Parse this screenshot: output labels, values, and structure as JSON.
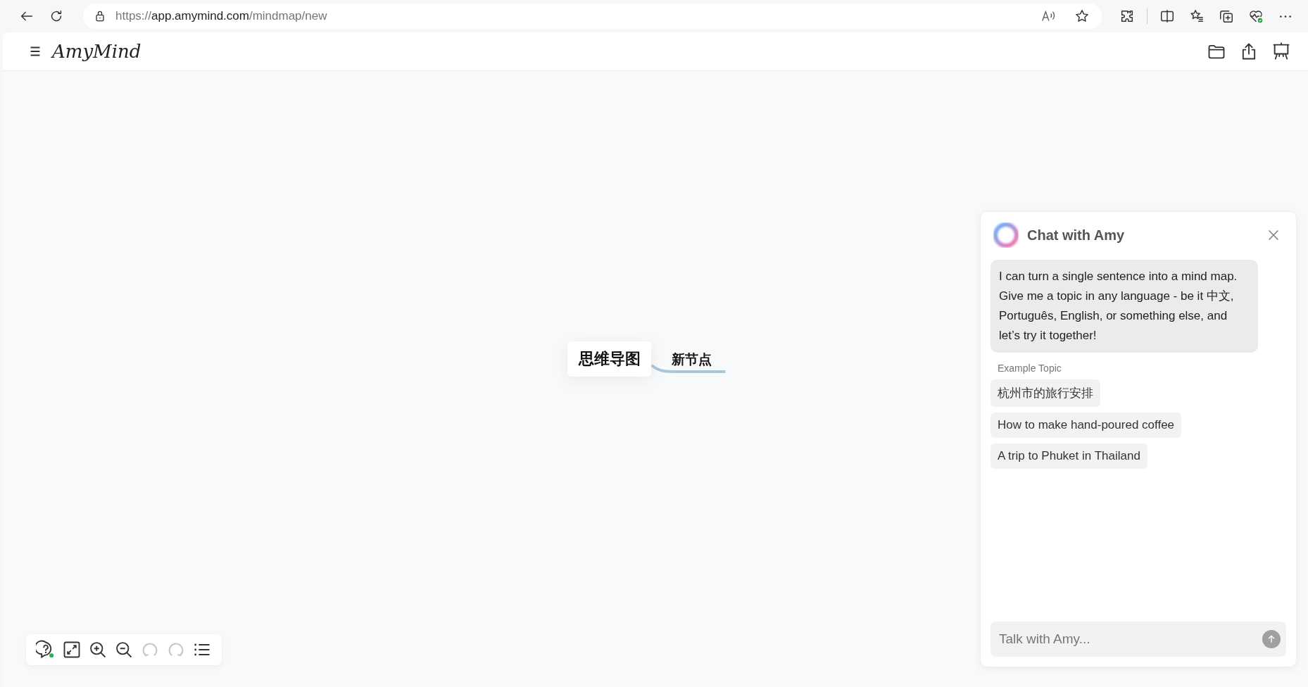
{
  "browser": {
    "url": {
      "scheme": "https://",
      "host": "app.amymind.com",
      "path": "/mindmap/new"
    }
  },
  "app_header": {
    "logo": "AmyMind"
  },
  "mindmap": {
    "root": "思维导图",
    "children": [
      {
        "label": "新节点"
      }
    ]
  },
  "toolbar": [
    {
      "kind": "help",
      "disabled": false
    },
    {
      "kind": "fit",
      "disabled": false
    },
    {
      "kind": "zoom-in",
      "disabled": false
    },
    {
      "kind": "zoom-out",
      "disabled": false
    },
    {
      "kind": "undo",
      "disabled": true
    },
    {
      "kind": "redo",
      "disabled": true
    },
    {
      "kind": "outline",
      "disabled": false
    }
  ],
  "chat": {
    "title": "Chat with Amy",
    "message": "I can turn a single sentence into a mind map. Give me a topic in any language - be it 中文, Português, English, or something else, and let’s try it together!",
    "examples_label": "Example Topic",
    "examples": [
      "杭州市的旅行安排",
      "How to make hand-poured coffee",
      "A trip to Phuket in Thailand"
    ],
    "input": {
      "placeholder": "Talk with Amy..."
    }
  }
}
